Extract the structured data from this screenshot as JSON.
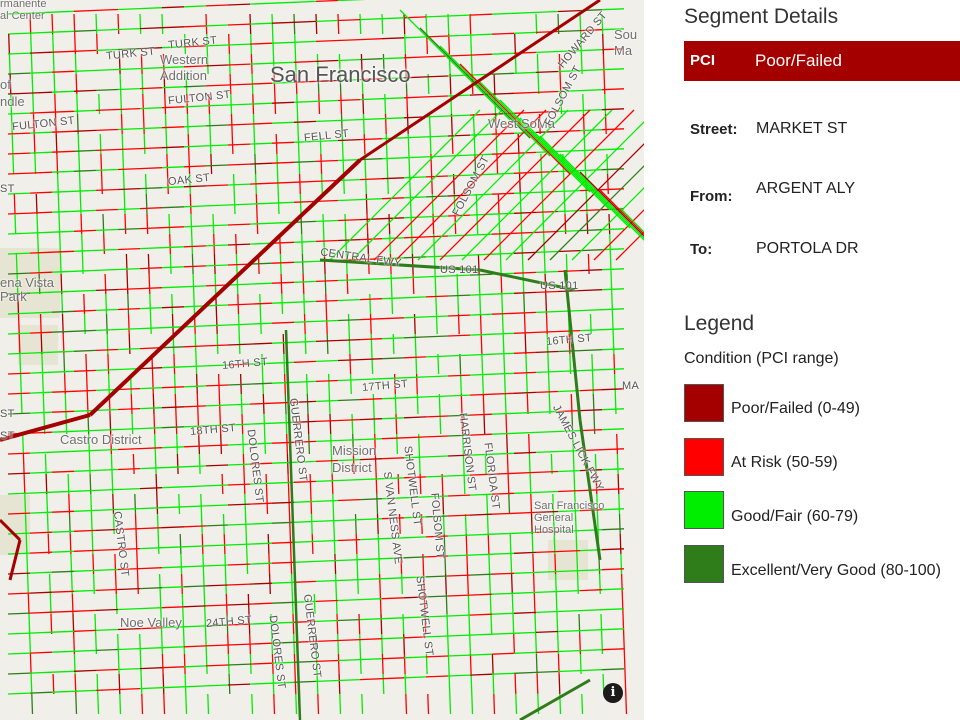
{
  "map": {
    "city_label": "San Francisco",
    "area_labels": {
      "western_addition": "Western\nAddition",
      "west_soma": "West SoMa",
      "buena_vista": "ena Vista\nPark",
      "castro": "Castro District",
      "mission": "Mission\nDistrict",
      "noe": "Noe Valley",
      "sfgh": "San Francisco\nGeneral\nHospital",
      "permanente": "rmanente\nal Center",
      "south": "Sou\nMa",
      "ofdle": "of\nndle"
    },
    "street_labels": {
      "turk": "TURK ST",
      "turk2": "TURK ST",
      "fulton": "FULTON ST",
      "fulton2": "FULTON ST",
      "fell": "FELL ST",
      "oak": "OAK ST",
      "central_fwy": "CENTRAL FWY",
      "us101": "US 101",
      "us101b": "US 101",
      "st16": "16TH ST",
      "st17": "17TH ST",
      "st18": "18TH ST",
      "st16b": "16TH ST",
      "st24": "24TH ST",
      "folsom": "FOLSOM ST",
      "folsom2": "FOLSOM ST",
      "folsom3": "FOLSOM ST",
      "howard": "HOWARD ST",
      "dolores": "DOLORES ST",
      "dolores2": "DOLORES ST",
      "guerrero": "GUERRERO ST",
      "guerrero2": "GUERRERO ST",
      "van_ness": "S VAN NESS AVE",
      "shotwell": "SHOTWELL ST",
      "shotwell2": "SHOTWELL ST",
      "harrison": "HARRISON ST",
      "florida": "FLORIDA ST",
      "castro_st": "CASTRO ST",
      "james_lick": "JAMES LICK FWY",
      "ma": "MA",
      "st_a": "ST",
      "st_b": "ST",
      "st_c": "ST"
    },
    "info_icon": "i"
  },
  "panel": {
    "title": "Segment Details",
    "pci_key": "PCI",
    "pci_value": "Poor/Failed",
    "street_key": "Street:",
    "street_value": "MARKET ST",
    "from_key": "From:",
    "from_value": "ARGENT ALY",
    "to_key": "To:",
    "to_value": "PORTOLA DR",
    "legend_title": "Legend",
    "legend_subtitle": "Condition (PCI range)",
    "legend": [
      {
        "label": "Poor/Failed (0-49)",
        "color": "#a50000"
      },
      {
        "label": "At Risk (50-59)",
        "color": "#ff0000"
      },
      {
        "label": "Good/Fair (60-79)",
        "color": "#00ee00"
      },
      {
        "label": "Excellent/Very Good (80-100)",
        "color": "#2e7d1a"
      }
    ]
  },
  "colors": {
    "poor": "#a50000",
    "risk": "#ff0000",
    "good": "#00ee00",
    "excellent": "#2e7d1a",
    "base_map": "#f1efea"
  }
}
